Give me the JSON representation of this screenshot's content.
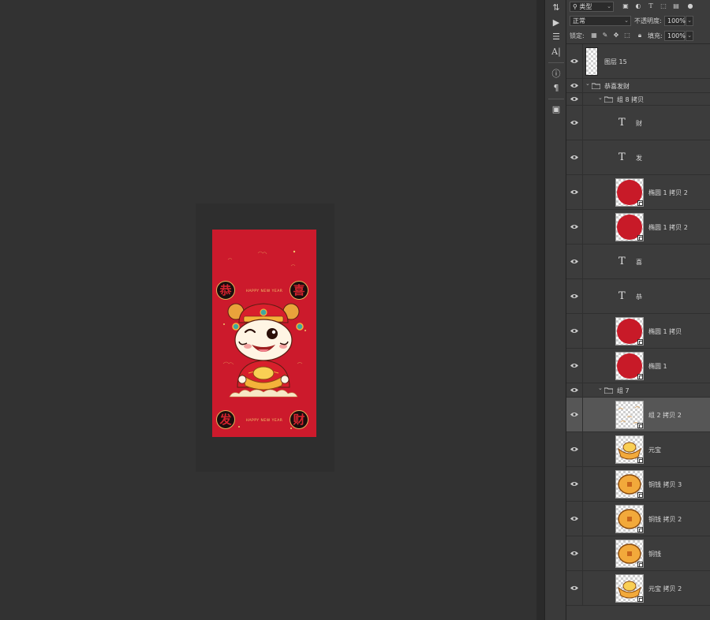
{
  "artwork": {
    "seals": [
      "恭",
      "喜",
      "发",
      "财"
    ],
    "banner_text": "HAPPY NEW YEAR",
    "colors": {
      "background": "#cc1a2c",
      "gold": "#f4b23a",
      "seal": "#1a0d0d"
    }
  },
  "tools": [
    "history-icon",
    "play-icon",
    "adjust-icon",
    "character-icon",
    "info-icon",
    "paragraph-icon",
    "properties-icon"
  ],
  "panel": {
    "filter": {
      "value": "类型",
      "icons": [
        "image-filter-icon",
        "adjustment-filter-icon",
        "type-filter-icon",
        "shape-filter-icon",
        "smart-filter-icon"
      ]
    },
    "blend": {
      "value": "正常",
      "opacity_label": "不透明度:",
      "opacity_value": "100%"
    },
    "lock": {
      "label": "锁定:",
      "fill_label": "填充:",
      "fill_value": "100%"
    },
    "layers": [
      {
        "name": "图层 15",
        "kind": "pixel-empty"
      },
      {
        "name": "恭喜发财",
        "kind": "group"
      },
      {
        "name": "组 8 拷贝",
        "kind": "group"
      },
      {
        "name": "财",
        "kind": "text"
      },
      {
        "name": "发",
        "kind": "text"
      },
      {
        "name": "椭圆 1 拷贝 2",
        "kind": "ellipse"
      },
      {
        "name": "椭圆 1 拷贝 2",
        "kind": "ellipse"
      },
      {
        "name": "喜",
        "kind": "text"
      },
      {
        "name": "恭",
        "kind": "text"
      },
      {
        "name": "椭圆 1 拷贝",
        "kind": "ellipse"
      },
      {
        "name": "椭圆 1",
        "kind": "ellipse"
      },
      {
        "name": "组 7",
        "kind": "group"
      },
      {
        "name": "组 2 拷贝 2",
        "kind": "pattern",
        "selected": true
      },
      {
        "name": "元宝",
        "kind": "ingot"
      },
      {
        "name": "铜钱 拷贝 3",
        "kind": "coin"
      },
      {
        "name": "铜钱 拷贝 2",
        "kind": "coin"
      },
      {
        "name": "铜钱",
        "kind": "coin"
      },
      {
        "name": "元宝 拷贝 2",
        "kind": "ingot"
      }
    ]
  }
}
